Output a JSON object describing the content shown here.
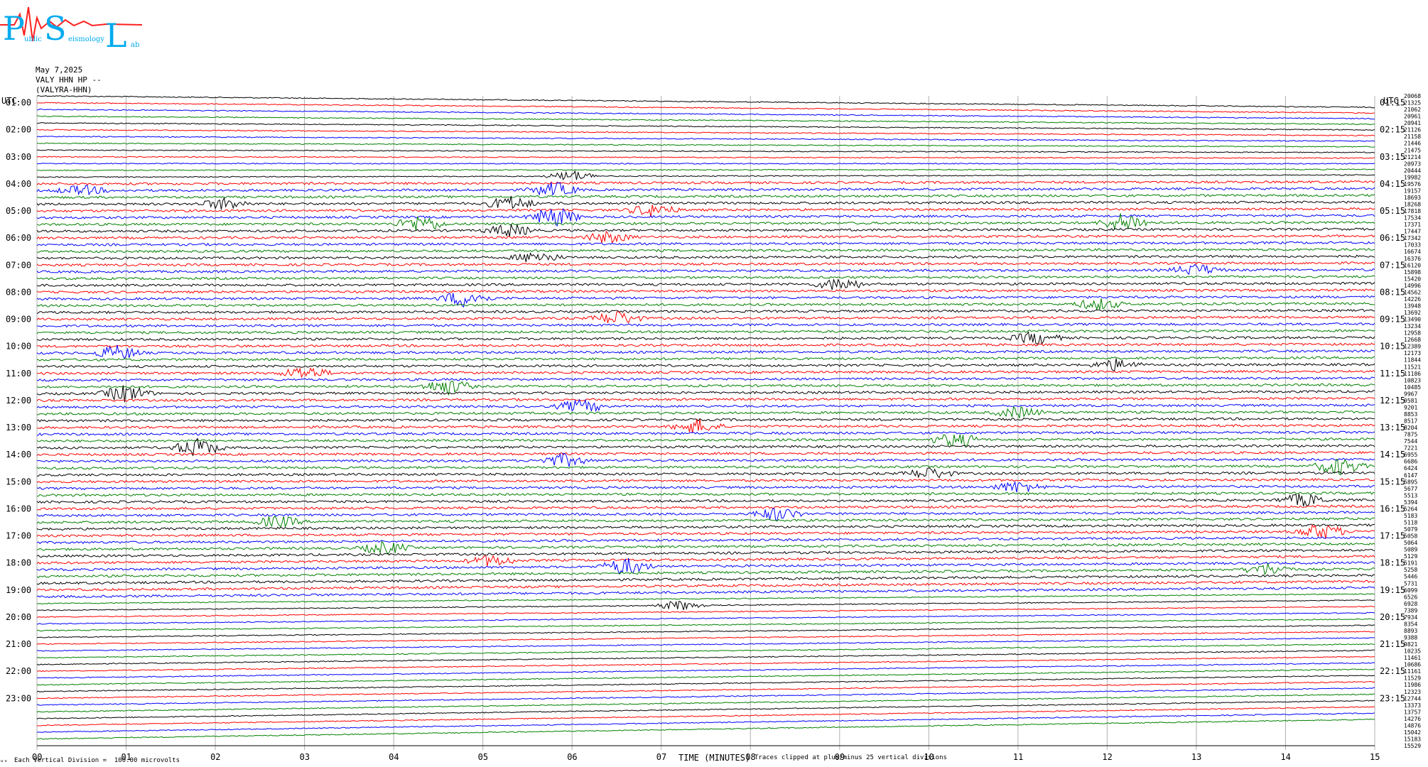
{
  "header": {
    "logo_letters": [
      "P",
      "S",
      "L"
    ],
    "logo_words": [
      "ublic",
      "eismology",
      "ab"
    ],
    "date": "May 7,2025",
    "station": "VALY HHN HP --",
    "station_name": "(VALYRA-HHN)"
  },
  "axis": {
    "utc_left": "UTC",
    "utc_right": "UTC",
    "xlabel": "TIME (MINUTES)",
    "clip_note": "Traces clipped at plus/minus 25 vertical divisions",
    "division_note": "Each Vertical Division =  100.00 microvolts",
    "corner_mark": "ᵤᵥ"
  },
  "chart_data": {
    "type": "line",
    "x_ticks": [
      "00",
      "01",
      "02",
      "03",
      "04",
      "05",
      "06",
      "07",
      "08",
      "09",
      "10",
      "11",
      "12",
      "13",
      "14",
      "15"
    ],
    "xlim": [
      0,
      15
    ],
    "hour_labels_left": [
      "01:00",
      "02:00",
      "03:00",
      "04:00",
      "05:00",
      "06:00",
      "07:00",
      "08:00",
      "09:00",
      "10:00",
      "11:00",
      "12:00",
      "13:00",
      "14:00",
      "15:00",
      "16:00",
      "17:00",
      "18:00",
      "19:00",
      "20:00",
      "21:00",
      "22:00",
      "23:00"
    ],
    "hour_labels_right": [
      "01:15",
      "02:15",
      "03:15",
      "04:15",
      "05:15",
      "06:15",
      "07:15",
      "08:15",
      "09:15",
      "10:15",
      "11:15",
      "12:15",
      "13:15",
      "14:15",
      "15:15",
      "16:15",
      "17:15",
      "18:15",
      "19:15",
      "20:15",
      "21:15",
      "22:15",
      "23:15"
    ],
    "trace_colors": [
      "#000000",
      "#ff0000",
      "#0000ff",
      "#008000"
    ],
    "trace_count": 96,
    "grid": true,
    "right_values": [
      "20068",
      "21325",
      "21062",
      "20961",
      "20941",
      "21126",
      "21158",
      "21446",
      "21475",
      "21214",
      "20973",
      "20444",
      "19982",
      "19576",
      "19157",
      "18693",
      "18268",
      "17818",
      "17534",
      "17371",
      "17447",
      "17342",
      "17033",
      "16674",
      "16376",
      "16120",
      "15898",
      "15420",
      "14996",
      "14562",
      "14226",
      "13948",
      "13692",
      "13490",
      "13234",
      "12958",
      "12668",
      "12389",
      "12173",
      "11844",
      "11521",
      "11186",
      "10823",
      "10485",
      "9967",
      "9581",
      "9201",
      "8853",
      "8517",
      "8204",
      "7875",
      "7544",
      "7221",
      "6955",
      "6686",
      "6424",
      "6147",
      "5895",
      "5677",
      "5513",
      "5394",
      "5264",
      "5183",
      "5118",
      "5079",
      "5058",
      "5064",
      "5089",
      "5129",
      "5191",
      "5258",
      "5446",
      "5731",
      "6099",
      "6526",
      "6928",
      "7389",
      "7934",
      "8354",
      "8893",
      "9388",
      "9821",
      "10235",
      "11461",
      "10686",
      "11161",
      "11529",
      "11986",
      "12323",
      "12744",
      "13373",
      "13757",
      "14276",
      "14876",
      "15042",
      "15183",
      "15529"
    ],
    "events": [
      {
        "trace": 12,
        "minute": 6.0,
        "amp": 8
      },
      {
        "trace": 14,
        "minute": 0.5,
        "amp": 7
      },
      {
        "trace": 14,
        "minute": 5.8,
        "amp": 10
      },
      {
        "trace": 16,
        "minute": 2.1,
        "amp": 8
      },
      {
        "trace": 16,
        "minute": 5.3,
        "amp": 10
      },
      {
        "trace": 17,
        "minute": 6.9,
        "amp": 9
      },
      {
        "trace": 18,
        "minute": 5.8,
        "amp": 14
      },
      {
        "trace": 19,
        "minute": 4.3,
        "amp": 12
      },
      {
        "trace": 19,
        "minute": 12.2,
        "amp": 14
      },
      {
        "trace": 20,
        "minute": 5.3,
        "amp": 9
      },
      {
        "trace": 21,
        "minute": 6.4,
        "amp": 8
      },
      {
        "trace": 24,
        "minute": 5.6,
        "amp": 8
      },
      {
        "trace": 26,
        "minute": 13.0,
        "amp": 8
      },
      {
        "trace": 28,
        "minute": 9.0,
        "amp": 9
      },
      {
        "trace": 30,
        "minute": 4.8,
        "amp": 12
      },
      {
        "trace": 31,
        "minute": 11.9,
        "amp": 8
      },
      {
        "trace": 33,
        "minute": 6.5,
        "amp": 10
      },
      {
        "trace": 36,
        "minute": 11.2,
        "amp": 9
      },
      {
        "trace": 38,
        "minute": 0.9,
        "amp": 10
      },
      {
        "trace": 40,
        "minute": 12.1,
        "amp": 8
      },
      {
        "trace": 41,
        "minute": 3.0,
        "amp": 9
      },
      {
        "trace": 43,
        "minute": 4.6,
        "amp": 11
      },
      {
        "trace": 44,
        "minute": 1.0,
        "amp": 12
      },
      {
        "trace": 46,
        "minute": 6.1,
        "amp": 9
      },
      {
        "trace": 47,
        "minute": 11.0,
        "amp": 8
      },
      {
        "trace": 49,
        "minute": 7.4,
        "amp": 10
      },
      {
        "trace": 51,
        "minute": 10.3,
        "amp": 10
      },
      {
        "trace": 52,
        "minute": 1.8,
        "amp": 13
      },
      {
        "trace": 54,
        "minute": 5.9,
        "amp": 9
      },
      {
        "trace": 55,
        "minute": 14.6,
        "amp": 12
      },
      {
        "trace": 56,
        "minute": 10.0,
        "amp": 8
      },
      {
        "trace": 58,
        "minute": 11.0,
        "amp": 8
      },
      {
        "trace": 60,
        "minute": 14.2,
        "amp": 9
      },
      {
        "trace": 62,
        "minute": 8.3,
        "amp": 9
      },
      {
        "trace": 63,
        "minute": 2.7,
        "amp": 8
      },
      {
        "trace": 65,
        "minute": 14.4,
        "amp": 11
      },
      {
        "trace": 67,
        "minute": 3.9,
        "amp": 9
      },
      {
        "trace": 69,
        "minute": 5.1,
        "amp": 8
      },
      {
        "trace": 70,
        "minute": 6.6,
        "amp": 12
      },
      {
        "trace": 71,
        "minute": 13.8,
        "amp": 8
      },
      {
        "trace": 76,
        "minute": 7.2,
        "amp": 7
      }
    ]
  }
}
